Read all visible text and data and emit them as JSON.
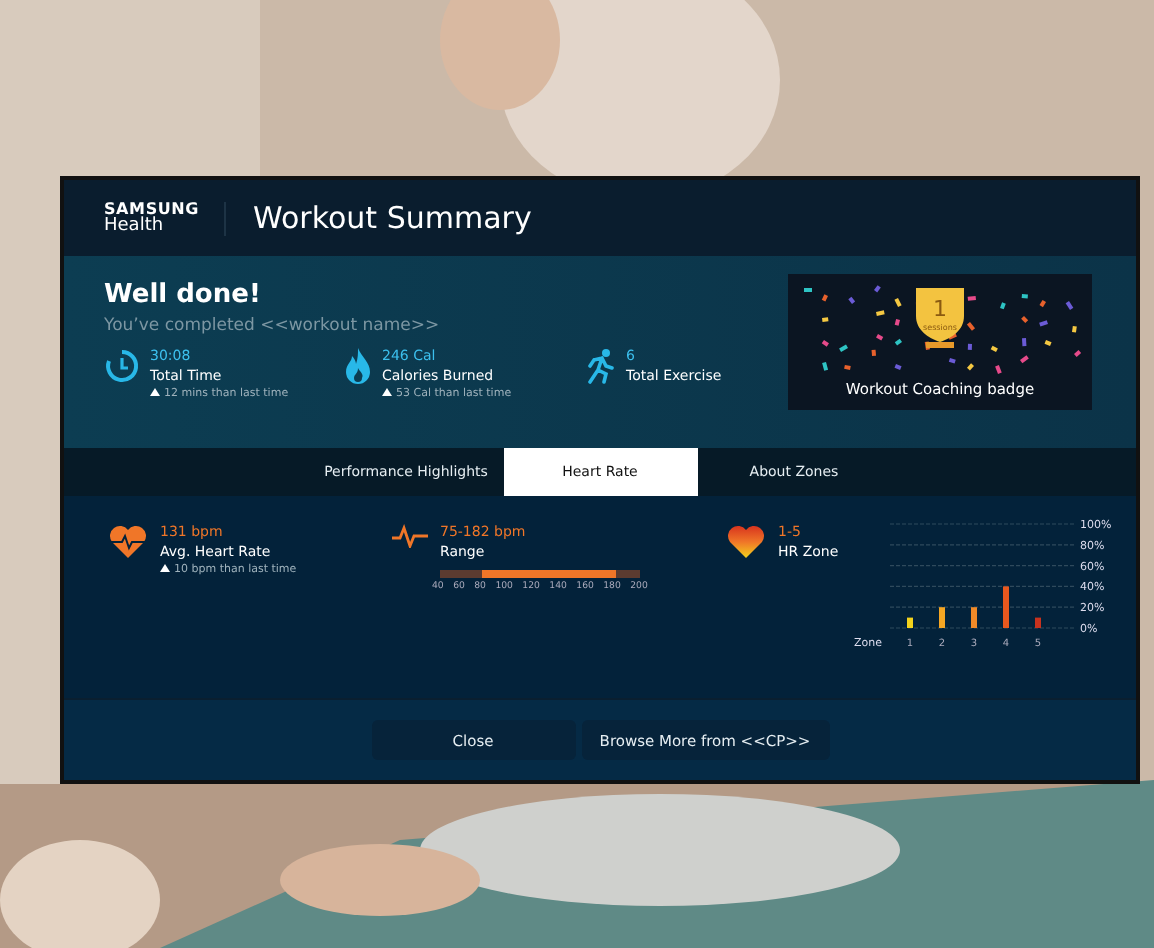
{
  "brand": {
    "line1": "SAMSUNG",
    "line2": "Health"
  },
  "title": "Workout Summary",
  "hero": {
    "heading": "Well done!",
    "subtitle": "You’ve completed <<workout name>>",
    "stats": [
      {
        "kind": "timer",
        "value": "30:08",
        "label": "Total Time",
        "note": "12 mins than last time"
      },
      {
        "kind": "flame",
        "value": "246 Cal",
        "label": "Calories Burned",
        "note": "53 Cal than last time"
      },
      {
        "kind": "runner",
        "value": "6",
        "label": "Total Exercise"
      }
    ],
    "badge": {
      "count": "1",
      "unit": "sessions",
      "caption": "Workout Coaching badge"
    }
  },
  "tabs": [
    {
      "label": "Performance Highlights",
      "selected": false
    },
    {
      "label": "Heart Rate",
      "selected": true
    },
    {
      "label": "About Zones",
      "selected": false
    }
  ],
  "heart": {
    "avg": {
      "value": "131 bpm",
      "label": "Avg. Heart Rate",
      "note": "10 bpm than last time"
    },
    "range": {
      "value": "75-182 bpm",
      "label": "Range",
      "bar": {
        "segments": [
          {
            "kind": "upper",
            "level": 0.88
          },
          {
            "kind": "lower",
            "level": 0.21
          }
        ],
        "scale": [
          "40",
          "60",
          "80",
          "100",
          "120",
          "140",
          "160",
          "180",
          "200"
        ]
      }
    },
    "zone": {
      "value": "1-5",
      "label": "HR Zone",
      "chart_data": {
        "type": "bar",
        "xlabel": "Zone",
        "categories": [
          "1",
          "2",
          "3",
          "4",
          "5"
        ],
        "ylim": [
          0,
          100
        ],
        "yticks": [
          {
            "value": 0,
            "label": "0%"
          },
          {
            "value": 20,
            "label": "20%"
          },
          {
            "value": 40,
            "label": "40%"
          },
          {
            "value": 60,
            "label": "60%"
          },
          {
            "value": 80,
            "label": "80%"
          },
          {
            "value": 100,
            "label": "100%"
          }
        ],
        "grid": true,
        "series": [
          {
            "color": "#f3d21c",
            "values": [
              10,
              null,
              null,
              null,
              null
            ]
          },
          {
            "color": "#f5a623",
            "values": [
              null,
              20,
              null,
              null,
              null
            ]
          },
          {
            "color": "#f08a28",
            "values": [
              null,
              null,
              20,
              null,
              null
            ]
          },
          {
            "color": "#e8581e",
            "values": [
              null,
              null,
              null,
              40,
              null
            ]
          },
          {
            "color": "#c8321e",
            "values": [
              null,
              null,
              null,
              null,
              10
            ]
          }
        ]
      }
    }
  },
  "buttons": [
    "Close",
    "Browse More from <<CP>>"
  ]
}
